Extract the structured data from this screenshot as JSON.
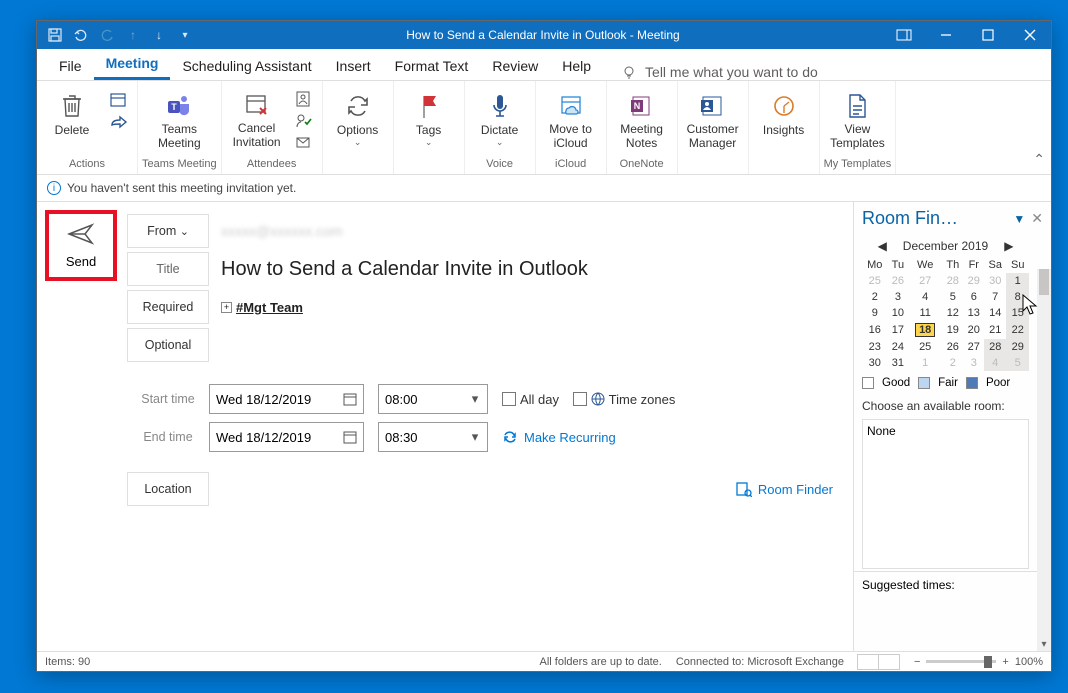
{
  "titlebar": {
    "title": "How to Send a Calendar Invite in Outlook  -  Meeting"
  },
  "tabs": {
    "file": "File",
    "meeting": "Meeting",
    "scheduling": "Scheduling Assistant",
    "insert": "Insert",
    "format": "Format Text",
    "review": "Review",
    "help": "Help",
    "search_hint": "Tell me what you want to do"
  },
  "ribbon": {
    "delete": "Delete",
    "teams": "Teams Meeting",
    "cancel": "Cancel Invitation",
    "options": "Options",
    "tags": "Tags",
    "dictate": "Dictate",
    "move_icloud": "Move to iCloud",
    "meeting_notes": "Meeting Notes",
    "customer_manager": "Customer Manager",
    "insights": "Insights",
    "view_templates": "View Templates",
    "groups": {
      "actions": "Actions",
      "teams": "Teams Meeting",
      "attendees": "Attendees",
      "voice": "Voice",
      "icloud": "iCloud",
      "onenote": "OneNote",
      "templates": "My Templates"
    }
  },
  "infobar": {
    "message": "You haven't sent this meeting invitation yet."
  },
  "send": {
    "label": "Send"
  },
  "fields": {
    "from_label": "From",
    "title_label": "Title",
    "required_label": "Required",
    "optional_label": "Optional",
    "start_label": "Start time",
    "end_label": "End time",
    "location_label": "Location",
    "title_value": "How to Send a Calendar Invite in Outlook",
    "required_value": "#Mgt Team",
    "start_date": "Wed 18/12/2019",
    "start_time": "08:00",
    "end_date": "Wed 18/12/2019",
    "end_time": "08:30",
    "all_day": "All day",
    "time_zones": "Time zones",
    "make_recurring": "Make Recurring",
    "room_finder": "Room Finder"
  },
  "roomfinder": {
    "title": "Room Fin…",
    "month": "December 2019",
    "dow": [
      "Mo",
      "Tu",
      "We",
      "Th",
      "Fr",
      "Sa",
      "Su"
    ],
    "rows": [
      {
        "cells": [
          "25",
          "26",
          "27",
          "28",
          "29",
          "30",
          "1"
        ],
        "dim": [
          0,
          1,
          2,
          3,
          4,
          5
        ],
        "shade": [
          6
        ]
      },
      {
        "cells": [
          "2",
          "3",
          "4",
          "5",
          "6",
          "7",
          "8"
        ],
        "shade": [
          6
        ]
      },
      {
        "cells": [
          "9",
          "10",
          "11",
          "12",
          "13",
          "14",
          "15"
        ],
        "shade": [
          6
        ]
      },
      {
        "cells": [
          "16",
          "17",
          "18",
          "19",
          "20",
          "21",
          "22"
        ],
        "today": 2,
        "shade": [
          6
        ]
      },
      {
        "cells": [
          "23",
          "24",
          "25",
          "26",
          "27",
          "28",
          "29"
        ],
        "shade": [
          5,
          6
        ]
      },
      {
        "cells": [
          "30",
          "31",
          "1",
          "2",
          "3",
          "4",
          "5"
        ],
        "dim": [
          2,
          3,
          4,
          5,
          6
        ],
        "shade": [
          5,
          6
        ]
      }
    ],
    "legend": {
      "good": "Good",
      "fair": "Fair",
      "poor": "Poor"
    },
    "choose_label": "Choose an available room:",
    "room_none": "None",
    "suggested": "Suggested times:"
  },
  "statusbar": {
    "items": "Items: 90",
    "folders": "All folders are up to date.",
    "connected": "Connected to: Microsoft Exchange",
    "zoom": "100%"
  }
}
